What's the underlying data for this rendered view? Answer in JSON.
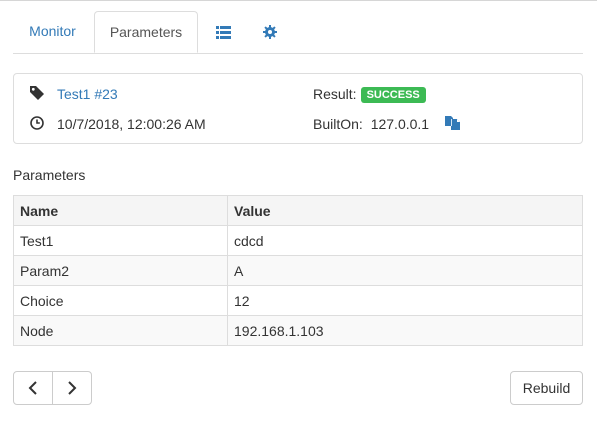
{
  "tabs": {
    "monitor": "Monitor",
    "parameters": "Parameters",
    "list_icon": "list-icon",
    "settings_icon": "gear-icon",
    "active": "Parameters"
  },
  "build": {
    "tag_icon": "tag-icon",
    "job_link": "Test1 #23",
    "clock_icon": "clock-icon",
    "timestamp": "10/7/2018, 12:00:26 AM",
    "result_label": "Result:",
    "result_badge": "SUCCESS",
    "built_on_label": "BuiltOn:",
    "built_on_value": "127.0.0.1",
    "copy_icon": "copy-icon"
  },
  "parameters": {
    "title": "Parameters",
    "columns": [
      "Name",
      "Value"
    ],
    "rows": [
      {
        "name": "Test1",
        "value": "cdcd"
      },
      {
        "name": "Param2",
        "value": "A"
      },
      {
        "name": "Choice",
        "value": "12"
      },
      {
        "name": "Node",
        "value": "192.168.1.103"
      }
    ]
  },
  "footer": {
    "prev_icon": "chevron-left-icon",
    "next_icon": "chevron-right-icon",
    "rebuild_label": "Rebuild"
  },
  "colors": {
    "link": "#337ab7",
    "success": "#3cba54",
    "border": "#dddddd",
    "header_bg": "#f5f5f5",
    "stripe_bg": "#f9f9f9"
  }
}
